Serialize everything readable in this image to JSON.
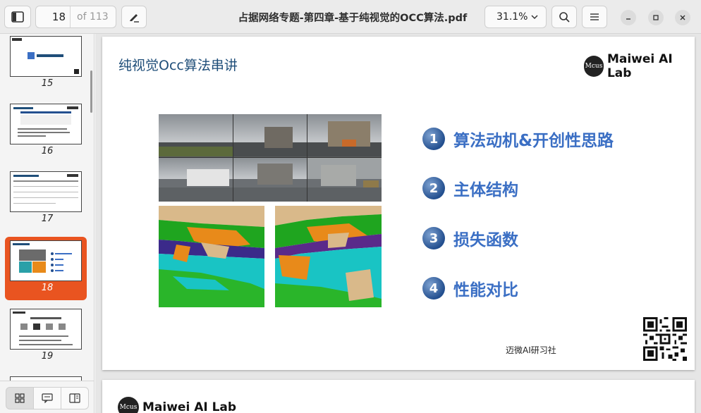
{
  "toolbar": {
    "page_current": "18",
    "page_total": "of 113",
    "document_title": "占据网络专题-第四章-基于纯视觉的OCC算法.pdf",
    "zoom": "31.1%"
  },
  "sidebar": {
    "thumbnails": [
      {
        "label": "15"
      },
      {
        "label": "16"
      },
      {
        "label": "17"
      },
      {
        "label": "18"
      },
      {
        "label": "19"
      }
    ]
  },
  "slide": {
    "title": "纯视觉Occ算法串讲",
    "logo_mark": "Mcus",
    "logo_text": "Maiwei AI Lab",
    "agenda": [
      {
        "num": "1",
        "label": "算法动机&开创性思路"
      },
      {
        "num": "2",
        "label": "主体结构"
      },
      {
        "num": "3",
        "label": "损失函数"
      },
      {
        "num": "4",
        "label": "性能对比"
      }
    ],
    "footer": "迈微AI研习社"
  },
  "next_slide": {
    "logo_text": "Maiwei AI Lab"
  },
  "colors": {
    "accent": "#e95420",
    "title_blue": "#1f4e79",
    "agenda_blue": "#3b6fc4"
  }
}
